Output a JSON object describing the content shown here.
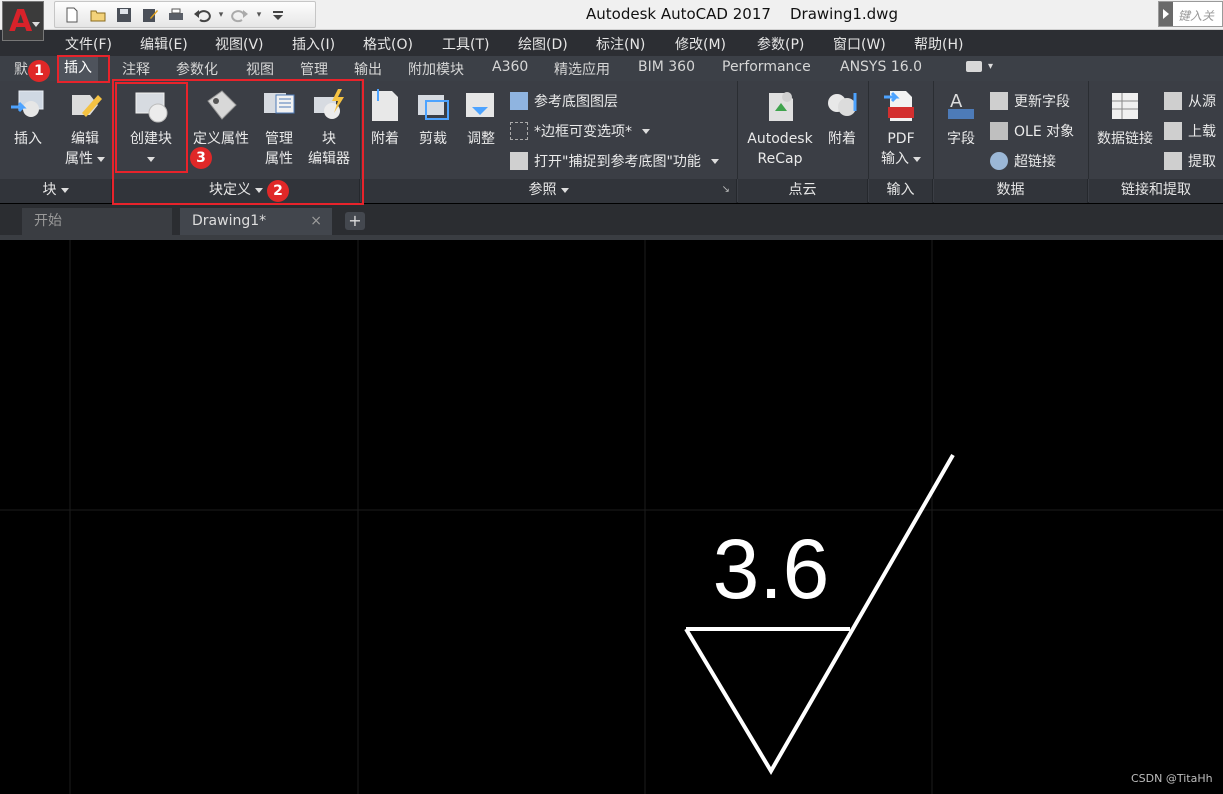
{
  "titlebar": {
    "app_letter": "A",
    "title": "Autodesk AutoCAD 2017    Drawing1.dwg",
    "search_placeholder": "键入关"
  },
  "menubar": [
    "文件(F)",
    "编辑(E)",
    "视图(V)",
    "插入(I)",
    "格式(O)",
    "工具(T)",
    "绘图(D)",
    "标注(N)",
    "修改(M)",
    "参数(P)",
    "窗口(W)",
    "帮助(H)"
  ],
  "ribbon_tabs": [
    "默",
    "插入",
    "注释",
    "参数化",
    "视图",
    "管理",
    "输出",
    "附加模块",
    "A360",
    "精选应用",
    "BIM 360",
    "Performance",
    "ANSYS 16.0"
  ],
  "ribbon": {
    "block_panel": {
      "insert": "插入",
      "edit_attr_1": "编辑",
      "edit_attr_2": "属性",
      "footer": "块"
    },
    "blockdef_panel": {
      "create_block": "创建块",
      "define_attr": "定义属性",
      "manage_attr_1": "管理",
      "manage_attr_2": "属性",
      "block_editor_1": "块",
      "block_editor_2": "编辑器",
      "footer": "块定义"
    },
    "reference_panel": {
      "attach": "附着",
      "clip": "剪裁",
      "adjust": "调整",
      "underlay_layers": "参考底图图层",
      "frames": "*边框可变选项*",
      "snap": "打开\"捕捉到参考底图\"功能",
      "footer": "参照"
    },
    "pointcloud_panel": {
      "recap_1": "Autodesk",
      "recap_2": "ReCap",
      "attach": "附着",
      "footer": "点云"
    },
    "import_panel": {
      "pdf_1": "PDF",
      "pdf_2": "输入",
      "footer": "输入"
    },
    "data_panel": {
      "field": "字段",
      "update_fields": "更新字段",
      "ole": "OLE 对象",
      "hyperlink": "超链接",
      "footer": "数据"
    },
    "link_panel": {
      "data_link": "数据链接",
      "from_source": "从源",
      "upload": "上载",
      "extract": "提取",
      "footer": "链接和提取"
    }
  },
  "file_tabs": {
    "start": "开始",
    "doc": "Drawing1*",
    "close": "×",
    "new": "+"
  },
  "drawing": {
    "roughness_value": "3.6"
  },
  "annotations": {
    "badge1": "1",
    "badge2": "2",
    "badge3": "3",
    "highlight_color": "#e8232b"
  },
  "watermark": "CSDN @TitaHh"
}
